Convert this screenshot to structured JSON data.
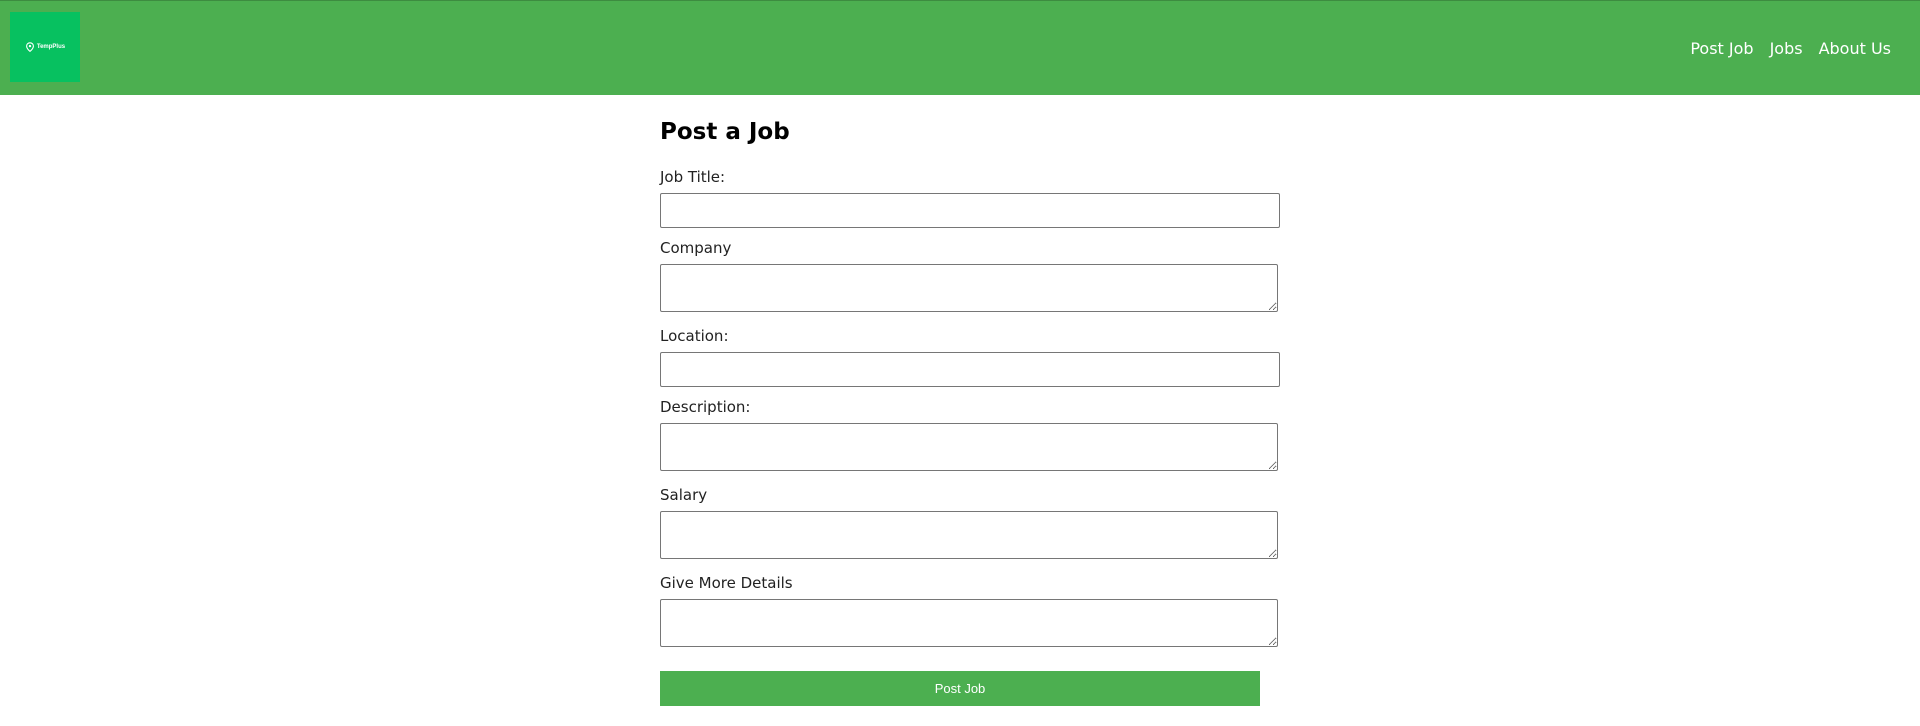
{
  "brand": {
    "logo_text": "TempPlus",
    "logo_color": "#07c160"
  },
  "colors": {
    "nav_background": "#4caf50",
    "button_background": "#4caf50"
  },
  "nav": {
    "items": [
      {
        "label": "Post Job"
      },
      {
        "label": "Jobs"
      },
      {
        "label": "About Us"
      }
    ]
  },
  "form": {
    "title": "Post a Job",
    "fields": {
      "job_title": {
        "label": "Job Title:",
        "value": ""
      },
      "company": {
        "label": "Company",
        "value": ""
      },
      "location": {
        "label": "Location:",
        "value": ""
      },
      "description": {
        "label": "Description:",
        "value": ""
      },
      "salary": {
        "label": "Salary",
        "value": ""
      },
      "details": {
        "label": "Give More Details",
        "value": ""
      }
    },
    "submit_label": "Post Job"
  }
}
